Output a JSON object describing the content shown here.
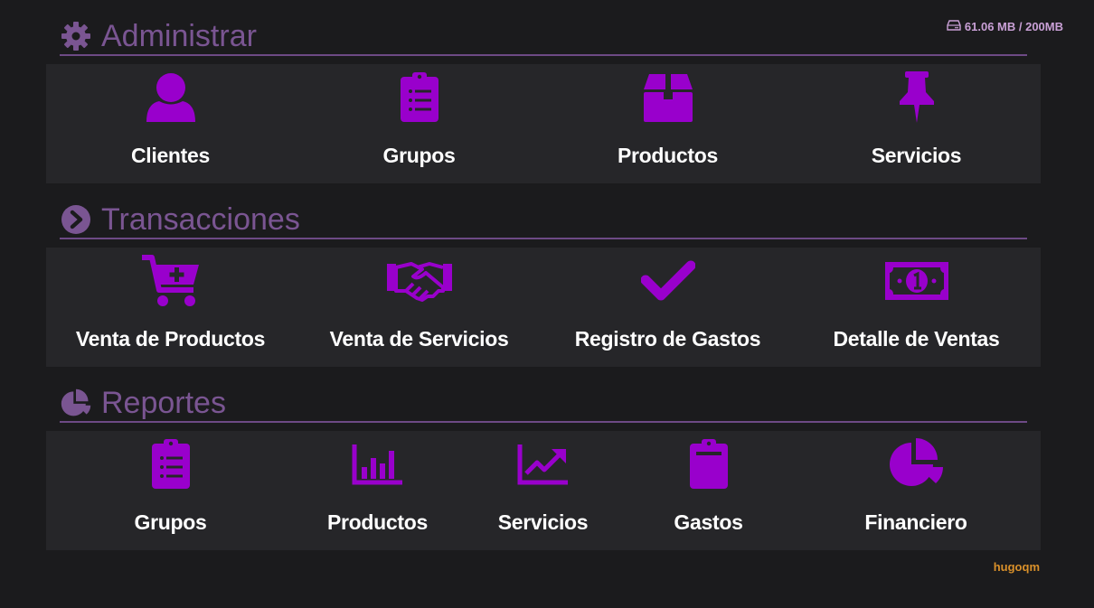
{
  "storage": {
    "text": "61.06 MB / 200MB",
    "icon": "hdd-icon"
  },
  "accent": "#9900cc",
  "sections": [
    {
      "title": "Administrar",
      "icon": "gear-icon",
      "items": [
        {
          "label": "Clientes",
          "icon": "user-icon"
        },
        {
          "label": "Grupos",
          "icon": "clipboard-list-icon"
        },
        {
          "label": "Productos",
          "icon": "box-icon"
        },
        {
          "label": "Servicios",
          "icon": "pushpin-icon"
        }
      ]
    },
    {
      "title": "Transacciones",
      "icon": "chevron-circle-right-icon",
      "items": [
        {
          "label": "Venta de Productos",
          "icon": "cart-plus-icon"
        },
        {
          "label": "Venta de Servicios",
          "icon": "handshake-icon"
        },
        {
          "label": "Registro de Gastos",
          "icon": "check-icon"
        },
        {
          "label": "Detalle de Ventas",
          "icon": "money-bill-icon"
        }
      ]
    },
    {
      "title": "Reportes",
      "icon": "pie-chart-icon",
      "items": [
        {
          "label": "Grupos",
          "icon": "clipboard-list-icon"
        },
        {
          "label": "Productos",
          "icon": "bar-chart-icon"
        },
        {
          "label": "Servicios",
          "icon": "trend-chart-icon"
        },
        {
          "label": "Gastos",
          "icon": "clipboard-icon"
        },
        {
          "label": "Financiero",
          "icon": "pie-chart-icon"
        }
      ]
    }
  ],
  "footer": {
    "user": "hugoqm"
  }
}
